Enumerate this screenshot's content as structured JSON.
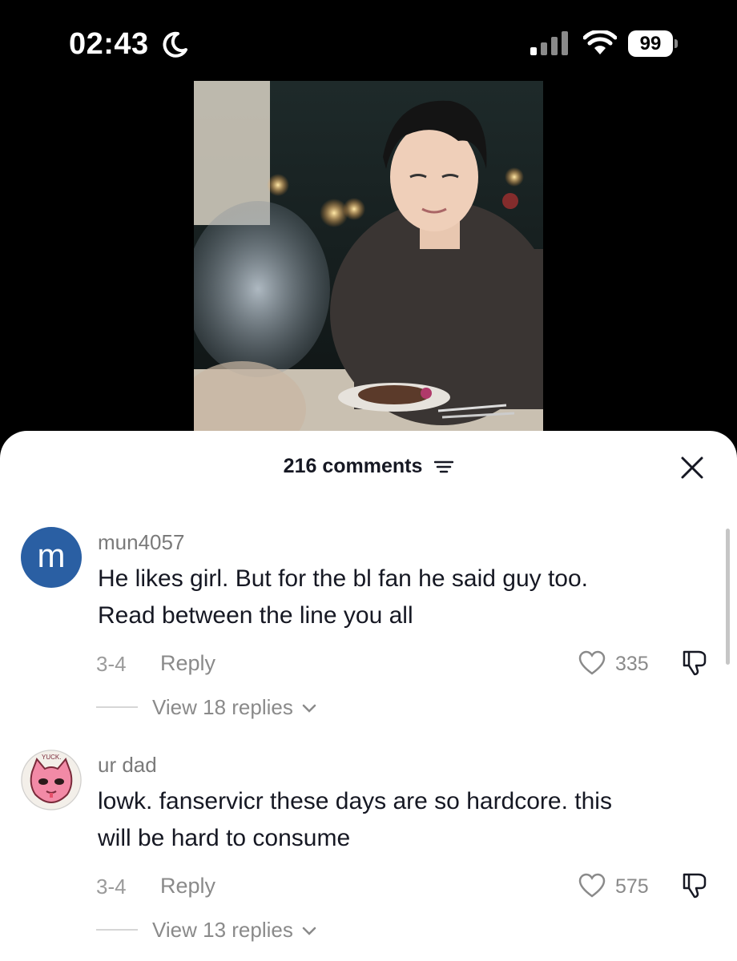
{
  "status_bar": {
    "time": "02:43",
    "focus_icon": "moon-icon",
    "signal_icon": "cellular-signal-icon",
    "wifi_icon": "wifi-icon",
    "battery_level": "99"
  },
  "video": {
    "description_icon": "video-frame"
  },
  "comments_sheet": {
    "title": "216 comments",
    "sort_icon": "sort-filter-icon",
    "close_icon": "close-icon",
    "comments": [
      {
        "avatar_letter": "m",
        "avatar_color": "#2a5fa3",
        "username": "mun4057",
        "text_line1": "He likes girl. But for the bl fan he said guy too.",
        "text_line2": "Read between the line you all",
        "date": "3-4",
        "reply_label": "Reply",
        "likes": "335",
        "view_replies": "View 18 replies"
      },
      {
        "avatar_label": "YUCK.",
        "avatar_color": "#f28aa6",
        "username": "ur dad",
        "text_line1": "lowk. fanservicr these days are so hardcore. this",
        "text_line2": "will be hard to consume",
        "date": "3-4",
        "reply_label": "Reply",
        "likes": "575",
        "view_replies": "View 13 replies"
      }
    ]
  }
}
